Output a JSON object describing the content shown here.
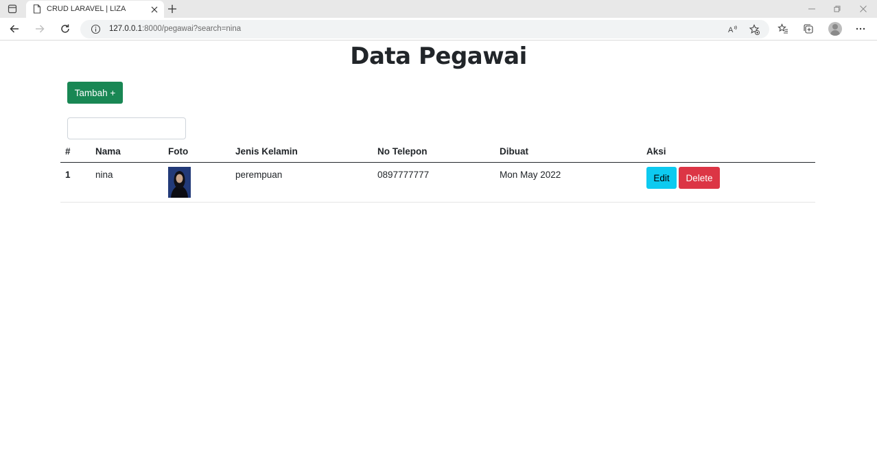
{
  "browser": {
    "tab_title": "CRUD LARAVEL | LIZA",
    "url_host": "127.0.0.1",
    "url_rest": ":8000/pegawai?search=nina",
    "reader_label": "A"
  },
  "page": {
    "title": "Data Pegawai",
    "add_button": "Tambah +",
    "search_value": ""
  },
  "table": {
    "headers": {
      "num": "#",
      "nama": "Nama",
      "foto": "Foto",
      "jenis_kelamin": "Jenis Kelamin",
      "no_telepon": "No Telepon",
      "dibuat": "Dibuat",
      "aksi": "Aksi"
    },
    "rows": [
      {
        "num": "1",
        "nama": "nina",
        "jenis_kelamin": "perempuan",
        "no_telepon": "0897777777",
        "dibuat": "Mon May 2022",
        "edit_label": "Edit",
        "delete_label": "Delete"
      }
    ]
  },
  "colors": {
    "add_button": "#198754",
    "edit_button": "#0dcaf0",
    "delete_button": "#dc3545"
  }
}
